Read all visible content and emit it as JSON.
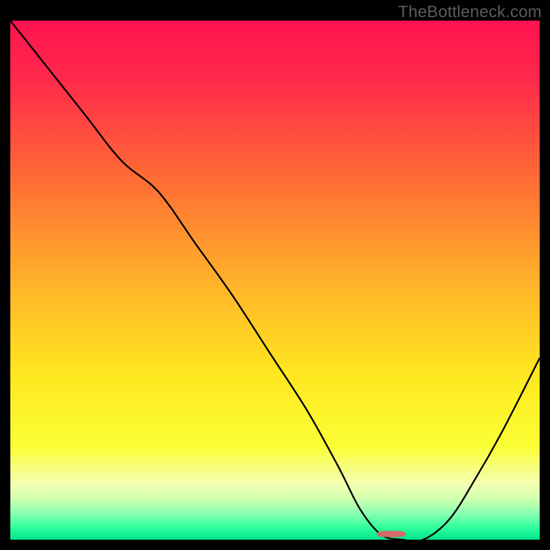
{
  "watermark": "TheBottleneck.com",
  "chart_data": {
    "type": "line",
    "title": "",
    "xlabel": "",
    "ylabel": "",
    "xlim": [
      0,
      100
    ],
    "ylim": [
      0,
      100
    ],
    "gradient_stops": [
      {
        "offset": 0,
        "color": "#ff1350"
      },
      {
        "offset": 0.12,
        "color": "#ff2b4a"
      },
      {
        "offset": 0.3,
        "color": "#ff6a35"
      },
      {
        "offset": 0.5,
        "color": "#ffb12a"
      },
      {
        "offset": 0.68,
        "color": "#ffe71f"
      },
      {
        "offset": 0.82,
        "color": "#fbff35"
      },
      {
        "offset": 0.89,
        "color": "#f5ffb0"
      },
      {
        "offset": 0.92,
        "color": "#d3ffb0"
      },
      {
        "offset": 0.95,
        "color": "#87ffb0"
      },
      {
        "offset": 0.975,
        "color": "#33ff9d"
      },
      {
        "offset": 1.0,
        "color": "#00e58b"
      }
    ],
    "curve": {
      "x": [
        0,
        7,
        14,
        21,
        28,
        35,
        42,
        49,
        56,
        62,
        66,
        70,
        74,
        78,
        83,
        88,
        93,
        100
      ],
      "y": [
        100,
        91,
        82,
        73,
        67,
        57,
        47,
        36,
        25,
        14,
        6,
        1,
        0,
        0,
        4,
        12,
        21,
        35
      ]
    },
    "marker": {
      "x": 72,
      "y": 0.5,
      "w": 5.5,
      "h": 1.2,
      "rx": 1.5,
      "color": "#d46a6a"
    }
  }
}
